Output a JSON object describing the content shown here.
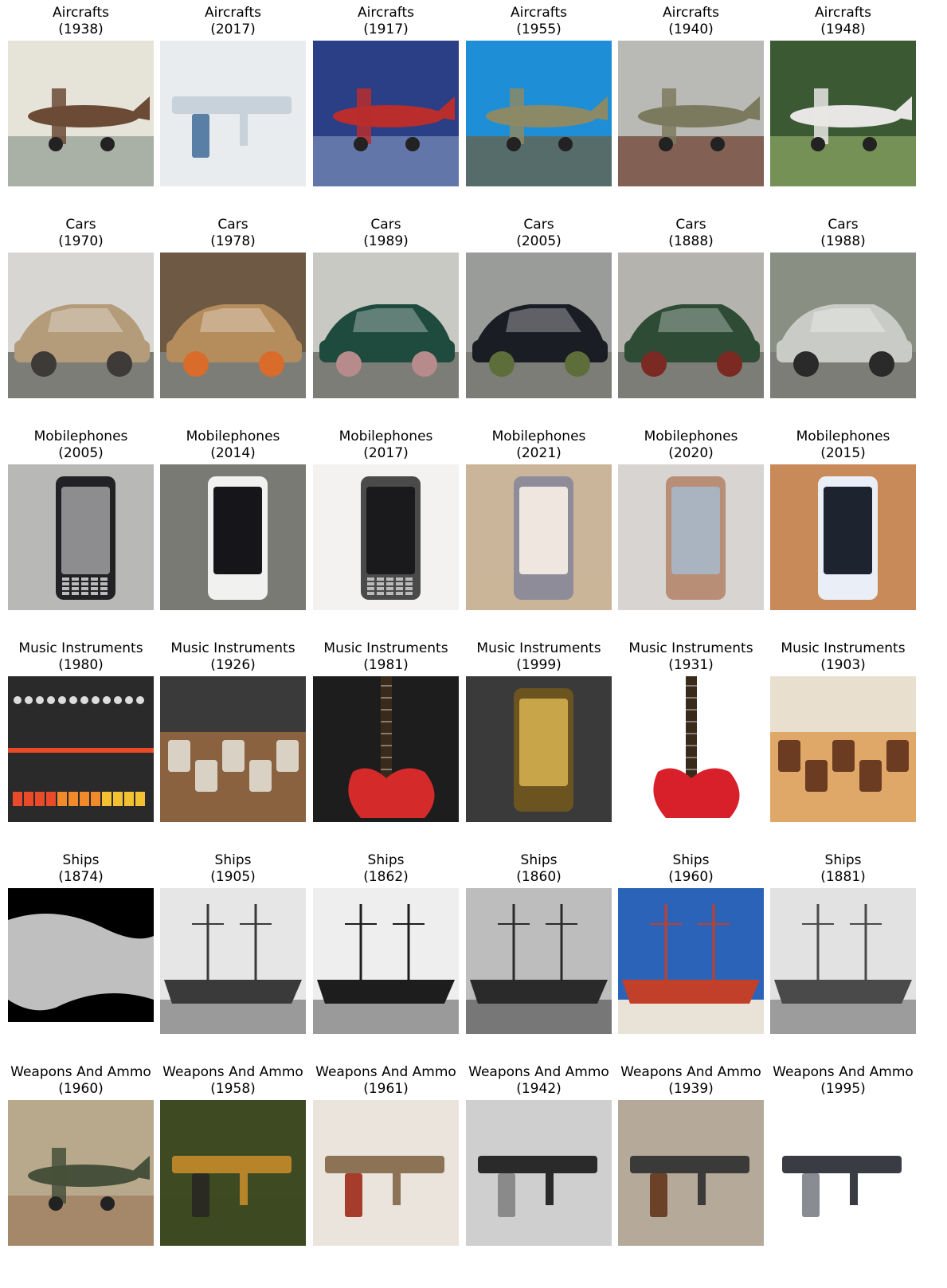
{
  "figure": {
    "rows": [
      {
        "category": "Aircrafts",
        "items": [
          {
            "title": "Aircrafts",
            "year": "(1938)",
            "depicts": "model-aircraft-display",
            "palette": [
              "#e6e3d8",
              "#6b4a36",
              "#8f9a92"
            ]
          },
          {
            "title": "Aircrafts",
            "year": "(2017)",
            "depicts": "airliner-models-expo",
            "palette": [
              "#e9ecef",
              "#c7d2da",
              "#5a7fa6"
            ]
          },
          {
            "title": "Aircrafts",
            "year": "(1917)",
            "depicts": "red-triplane-museum",
            "palette": [
              "#2b3f86",
              "#b92d2d",
              "#7a8fb8"
            ]
          },
          {
            "title": "Aircrafts",
            "year": "(1955)",
            "depicts": "green-trainer-aircraft",
            "palette": [
              "#1e8fd6",
              "#8c8a66",
              "#6d5c3c"
            ]
          },
          {
            "title": "Aircrafts",
            "year": "(1940)",
            "depicts": "bomber-in-hangar",
            "palette": [
              "#b9b9b6",
              "#7c7a5e",
              "#6b3a2a"
            ]
          },
          {
            "title": "Aircrafts",
            "year": "(1948)",
            "depicts": "light-aircraft-field",
            "palette": [
              "#3b5a33",
              "#e8e6e4",
              "#8fa864"
            ]
          }
        ]
      },
      {
        "category": "Cars",
        "items": [
          {
            "title": "Cars",
            "year": "(1970)",
            "depicts": "gold-sports-car",
            "palette": [
              "#d8d6d2",
              "#b49b7a",
              "#3d3a38"
            ]
          },
          {
            "title": "Cars",
            "year": "(1978)",
            "depicts": "car-interior-steering",
            "palette": [
              "#6e5a44",
              "#b58c5c",
              "#d96b2b"
            ]
          },
          {
            "title": "Cars",
            "year": "(1989)",
            "depicts": "green-mini",
            "palette": [
              "#c9c9c4",
              "#1f4a3e",
              "#b78b8b"
            ]
          },
          {
            "title": "Cars",
            "year": "(2005)",
            "depicts": "black-sedan",
            "palette": [
              "#9a9c9a",
              "#1a1d24",
              "#5e6e3a"
            ]
          },
          {
            "title": "Cars",
            "year": "(1888)",
            "depicts": "horse-carriage",
            "palette": [
              "#b5b3ae",
              "#2d4b35",
              "#7a2a22"
            ]
          },
          {
            "title": "Cars",
            "year": "(1988)",
            "depicts": "silver-convertible",
            "palette": [
              "#8a8f84",
              "#c9ccc6",
              "#2a2a2a"
            ]
          }
        ]
      },
      {
        "category": "Mobilephones",
        "items": [
          {
            "title": "Mobilephones",
            "year": "(2005)",
            "depicts": "slider-phone-keyboard",
            "palette": [
              "#b8b8b6",
              "#8d8d90",
              "#222226"
            ]
          },
          {
            "title": "Mobilephones",
            "year": "(2014)",
            "depicts": "two-phones-table",
            "palette": [
              "#7a7a74",
              "#16161a",
              "#f1f1ef"
            ]
          },
          {
            "title": "Mobilephones",
            "year": "(2017)",
            "depicts": "blackberry-keyone",
            "palette": [
              "#f3f2f0",
              "#1a1a1c",
              "#4a4a4a"
            ]
          },
          {
            "title": "Mobilephones",
            "year": "(2021)",
            "depicts": "phone-store-display",
            "palette": [
              "#cbb59a",
              "#efe7df",
              "#8f8c9a"
            ]
          },
          {
            "title": "Mobilephones",
            "year": "(2020)",
            "depicts": "honor-phone-hand",
            "palette": [
              "#d7d4d2",
              "#aab3c0",
              "#b98e76"
            ]
          },
          {
            "title": "Mobilephones",
            "year": "(2015)",
            "depicts": "phone-on-desk",
            "palette": [
              "#c98a5a",
              "#1d2430",
              "#e9eef7"
            ]
          }
        ]
      },
      {
        "category": "Music Instruments",
        "items": [
          {
            "title": "Music Instruments",
            "year": "(1980)",
            "depicts": "drum-machine-panel",
            "palette": [
              "#2a2a2a",
              "#e84a2a",
              "#f2c233"
            ]
          },
          {
            "title": "Music Instruments",
            "year": "(1926)",
            "depicts": "room-with-equipment",
            "palette": [
              "#8a6240",
              "#d9d2c4",
              "#3a3a3a"
            ]
          },
          {
            "title": "Music Instruments",
            "year": "(1981)",
            "depicts": "red-electric-guitar",
            "palette": [
              "#1d1d1d",
              "#d42a2a",
              "#f4f4f0"
            ]
          },
          {
            "title": "Music Instruments",
            "year": "(1999)",
            "depicts": "saxophone",
            "palette": [
              "#3a3a3a",
              "#c9a54a",
              "#6b5420"
            ]
          },
          {
            "title": "Music Instruments",
            "year": "(1931)",
            "depicts": "guitar-diagram",
            "palette": [
              "#ffffff",
              "#d8202a",
              "#2a2a2a"
            ]
          },
          {
            "title": "Music Instruments",
            "year": "(1903)",
            "depicts": "zithers-on-wall",
            "palette": [
              "#e0a868",
              "#6b3c22",
              "#e9dfcf"
            ]
          }
        ]
      },
      {
        "category": "Ships",
        "items": [
          {
            "title": "Ships",
            "year": "(1874)",
            "depicts": "wreckage-engraving",
            "palette": [
              "#000000",
              "#ffffff",
              "#7a7a7a"
            ]
          },
          {
            "title": "Ships",
            "year": "(1905)",
            "depicts": "battleship-photo",
            "palette": [
              "#e6e6e6",
              "#3a3a3a",
              "#9a9a9a"
            ]
          },
          {
            "title": "Ships",
            "year": "(1862)",
            "depicts": "sailing-ship-masts",
            "palette": [
              "#eeeeee",
              "#1d1d1d",
              "#9a9a9a"
            ]
          },
          {
            "title": "Ships",
            "year": "(1860)",
            "depicts": "steam-sailing-ship",
            "palette": [
              "#bdbdbd",
              "#2a2a2a",
              "#777777"
            ]
          },
          {
            "title": "Ships",
            "year": "(1960)",
            "depicts": "icebreaker-sampo",
            "palette": [
              "#2b63b8",
              "#c2402a",
              "#e9e2d6"
            ]
          },
          {
            "title": "Ships",
            "year": "(1881)",
            "depicts": "ship-at-pier",
            "palette": [
              "#e2e2e2",
              "#4a4a4a",
              "#9c9c9c"
            ]
          }
        ]
      },
      {
        "category": "Weapons And Ammo",
        "items": [
          {
            "title": "Weapons And Ammo",
            "year": "(1960)",
            "depicts": "anti-aircraft-gun",
            "palette": [
              "#b8a88c",
              "#46503a",
              "#9c7a5a"
            ]
          },
          {
            "title": "Weapons And Ammo",
            "year": "(1958)",
            "depicts": "machine-gun-leaves",
            "palette": [
              "#3e4a22",
              "#b7842a",
              "#2a2a22"
            ]
          },
          {
            "title": "Weapons And Ammo",
            "year": "(1961)",
            "depicts": "soldier-with-rifle",
            "palette": [
              "#eae4dc",
              "#8d7356",
              "#a63c2c"
            ]
          },
          {
            "title": "Weapons And Ammo",
            "year": "(1942)",
            "depicts": "soldiers-prone-bw",
            "palette": [
              "#cfcfcf",
              "#2a2a2a",
              "#8a8a8a"
            ]
          },
          {
            "title": "Weapons And Ammo",
            "year": "(1939)",
            "depicts": "submachine-gun",
            "palette": [
              "#b5aa9a",
              "#3a3a38",
              "#6b4228"
            ]
          },
          {
            "title": "Weapons And Ammo",
            "year": "(1995)",
            "depicts": "assault-rifle",
            "palette": [
              "#ffffff",
              "#3a3c44",
              "#8a8c94"
            ]
          }
        ]
      }
    ]
  }
}
